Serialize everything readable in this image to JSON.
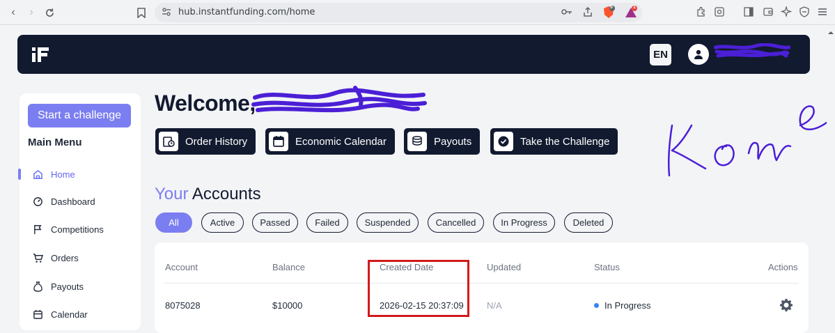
{
  "browser": {
    "url": "hub.instantfunding.com/home",
    "extension_badges": [
      "5",
      "1"
    ]
  },
  "header": {
    "language": "EN"
  },
  "sidebar": {
    "start_button": "Start a challenge",
    "menu_title": "Main Menu",
    "items": [
      {
        "label": "Home",
        "icon": "home-icon",
        "active": true
      },
      {
        "label": "Dashboard",
        "icon": "dashboard-icon",
        "active": false
      },
      {
        "label": "Competitions",
        "icon": "flag-icon",
        "active": false
      },
      {
        "label": "Orders",
        "icon": "cart-icon",
        "active": false
      },
      {
        "label": "Payouts",
        "icon": "money-bag-icon",
        "active": false
      },
      {
        "label": "Calendar",
        "icon": "calendar-icon",
        "active": false
      }
    ]
  },
  "main": {
    "welcome": "Welcome,",
    "quick_actions": [
      {
        "label": "Order History",
        "icon": "order-history-icon"
      },
      {
        "label": "Economic Calendar",
        "icon": "calendar-icon"
      },
      {
        "label": "Payouts",
        "icon": "coins-icon"
      },
      {
        "label": "Take the Challenge",
        "icon": "badge-check-icon"
      }
    ],
    "accounts_title_prefix": "Your",
    "accounts_title_suffix": " Accounts",
    "filters": [
      "All",
      "Active",
      "Passed",
      "Failed",
      "Suspended",
      "Cancelled",
      "In Progress",
      "Deleted"
    ],
    "active_filter": "All",
    "table": {
      "columns": [
        "Account",
        "Balance",
        "Created Date",
        "Updated",
        "Status",
        "Actions"
      ],
      "rows": [
        {
          "account": "8075028",
          "balance": "$10000",
          "created": "2026-02-15 20:37:09",
          "updated": "N/A",
          "status": "In Progress"
        }
      ]
    }
  },
  "annotations": {
    "handwriting": "Kome"
  },
  "colors": {
    "navy": "#121a30",
    "accent": "#7b7ef0",
    "highlight_box": "#d11a1a",
    "scribble": "#4b1fd6"
  }
}
